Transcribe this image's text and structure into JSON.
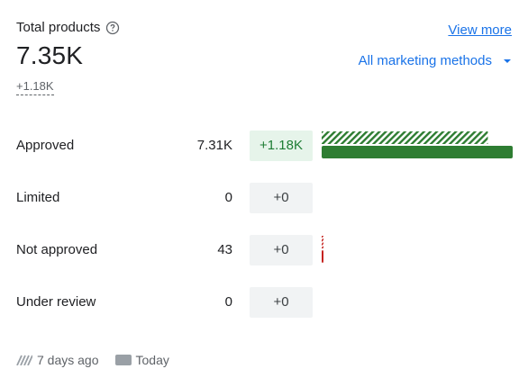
{
  "header": {
    "title": "Total products",
    "total_value": "7.35K",
    "total_delta": "+1.18K",
    "view_more_label": "View more",
    "method_label": "All marketing methods"
  },
  "rows": [
    {
      "label": "Approved",
      "count": "7.31K",
      "delta": "+1.18K",
      "bar_prev_fraction": 0.87,
      "bar_today_fraction": 1.0
    },
    {
      "label": "Limited",
      "count": "0",
      "delta": "+0",
      "bar_prev_fraction": 0,
      "bar_today_fraction": 0
    },
    {
      "label": "Not approved",
      "count": "43",
      "delta": "+0",
      "bar_prev_fraction": 0.006,
      "bar_today_fraction": 0.006
    },
    {
      "label": "Under review",
      "count": "0",
      "delta": "+0",
      "bar_prev_fraction": 0,
      "bar_today_fraction": 0
    }
  ],
  "legend": {
    "previous_label": "7 days ago",
    "today_label": "Today"
  },
  "colors": {
    "link": "#1a73e8",
    "approved_bar": "#2e7d32",
    "not_approved_bar": "#c5221f",
    "positive_delta_bg": "#e6f4ea",
    "zero_delta_bg": "#f1f3f4"
  }
}
